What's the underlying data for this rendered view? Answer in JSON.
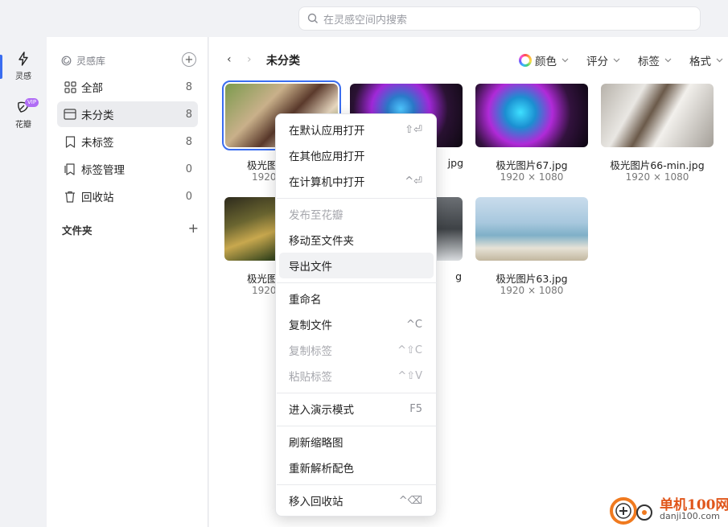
{
  "search": {
    "placeholder": "在灵感空间内搜索"
  },
  "rail": {
    "items": [
      {
        "label": "灵感",
        "icon": "lightning-icon"
      },
      {
        "label": "花瓣",
        "icon": "petal-icon",
        "badge": "VIP"
      }
    ]
  },
  "sidebar": {
    "library_title": "灵感库",
    "items": [
      {
        "label": "全部",
        "count": "8",
        "icon": "grid-icon"
      },
      {
        "label": "未分类",
        "count": "8",
        "icon": "folder-tray-icon"
      },
      {
        "label": "未标签",
        "count": "8",
        "icon": "bookmark-icon"
      },
      {
        "label": "标签管理",
        "count": "0",
        "icon": "tag-manage-icon"
      },
      {
        "label": "回收站",
        "count": "0",
        "icon": "trash-icon"
      }
    ],
    "folder_title": "文件夹",
    "folder_add": "+"
  },
  "main": {
    "breadcrumb": "未分类",
    "filters": {
      "color": "颜色",
      "rating": "评分",
      "tags": "标签",
      "format": "格式"
    },
    "items": [
      {
        "name": "极光图",
        "size": "1920"
      },
      {
        "name": "jpg",
        "size": ""
      },
      {
        "name": "极光图片67.jpg",
        "size": "1920 × 1080"
      },
      {
        "name": "极光图片66-min.jpg",
        "size": "1920 × 1080"
      },
      {
        "name": "极光图",
        "size": "1920"
      },
      {
        "name": "g",
        "size": ""
      },
      {
        "name": "极光图片63.jpg",
        "size": "1920 × 1080"
      }
    ]
  },
  "context_menu": {
    "items": [
      {
        "label": "在默认应用打开",
        "shortcut": "⇧⏎",
        "disabled": false
      },
      {
        "label": "在其他应用打开",
        "shortcut": "",
        "disabled": false
      },
      {
        "label": "在计算机中打开",
        "shortcut": "^⏎",
        "disabled": false
      },
      {
        "label": "发布至花瓣",
        "shortcut": "",
        "disabled": true
      },
      {
        "label": "移动至文件夹",
        "shortcut": "",
        "disabled": false
      },
      {
        "label": "导出文件",
        "shortcut": "",
        "disabled": false
      },
      {
        "label": "重命名",
        "shortcut": "",
        "disabled": false
      },
      {
        "label": "复制文件",
        "shortcut": "^C",
        "disabled": false
      },
      {
        "label": "复制标签",
        "shortcut": "^⇧C",
        "disabled": true
      },
      {
        "label": "粘贴标签",
        "shortcut": "^⇧V",
        "disabled": true
      },
      {
        "label": "进入演示模式",
        "shortcut": "F5",
        "disabled": false
      },
      {
        "label": "刷新缩略图",
        "shortcut": "",
        "disabled": false
      },
      {
        "label": "重新解析配色",
        "shortcut": "",
        "disabled": false
      },
      {
        "label": "移入回收站",
        "shortcut": "^⌫",
        "disabled": false
      }
    ]
  },
  "watermark": {
    "title": "单机100网",
    "url": "danji100.com"
  },
  "colors": {
    "accent": "#3a6df0",
    "watermark": "#e0561b"
  }
}
